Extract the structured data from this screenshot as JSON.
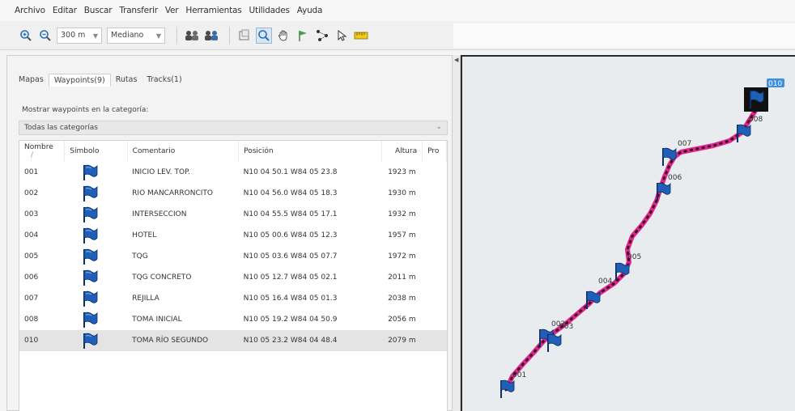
{
  "menu": [
    "Archivo",
    "Editar",
    "Buscar",
    "Transferir",
    "Ver",
    "Herramientas",
    "Utilidades",
    "Ayuda"
  ],
  "toolbar": {
    "zoom_value": "300 m",
    "detail_value": "Mediano"
  },
  "tabs": [
    {
      "label": "Mapas",
      "active": false
    },
    {
      "label": "Waypoints(9)",
      "active": true
    },
    {
      "label": "Rutas",
      "active": false
    },
    {
      "label": "Tracks(1)",
      "active": false
    }
  ],
  "category": {
    "label": "Mostrar waypoints en la categoría:",
    "selected": "Todas las categorías"
  },
  "columns": {
    "name": "Nombre",
    "symbol": "Símbolo",
    "comment": "Comentario",
    "position": "Posición",
    "altitude": "Altura",
    "extra": "Pro"
  },
  "waypoints": [
    {
      "name": "001",
      "comment": "INICIO LEV. TOP.",
      "position": "N10 04 50.1 W84 05 23.8",
      "altitude": "1923 m"
    },
    {
      "name": "002",
      "comment": "RIO MANCARRONCITO",
      "position": "N10 04 56.0 W84 05 18.3",
      "altitude": "1930 m"
    },
    {
      "name": "003",
      "comment": "INTERSECCION",
      "position": "N10 04 55.5 W84 05 17.1",
      "altitude": "1932 m"
    },
    {
      "name": "004",
      "comment": "HOTEL",
      "position": "N10 05 00.6 W84 05 12.3",
      "altitude": "1957 m"
    },
    {
      "name": "005",
      "comment": "TQG",
      "position": "N10 05 03.6 W84 05 07.7",
      "altitude": "1972 m"
    },
    {
      "name": "006",
      "comment": "TQG CONCRETO",
      "position": "N10 05 12.7 W84 05 02.1",
      "altitude": "2011 m"
    },
    {
      "name": "007",
      "comment": "REJILLA",
      "position": "N10 05 16.4 W84 05 01.3",
      "altitude": "2038 m"
    },
    {
      "name": "008",
      "comment": "TOMA INICIAL",
      "position": "N10 05 19.2 W84 04 50.9",
      "altitude": "2056 m"
    },
    {
      "name": "010",
      "comment": "TOMA RÍO SEGUNDO",
      "position": "N10 05 23.2 W84 04 48.4",
      "altitude": "2079 m",
      "selected": true
    }
  ],
  "map": {
    "labels": [
      "001",
      "002",
      "003",
      "004",
      "005",
      "006",
      "007",
      "008",
      "010"
    ],
    "selected_label": "010",
    "track_color": "#e0288c",
    "flag_color": "#1f5fb8"
  }
}
